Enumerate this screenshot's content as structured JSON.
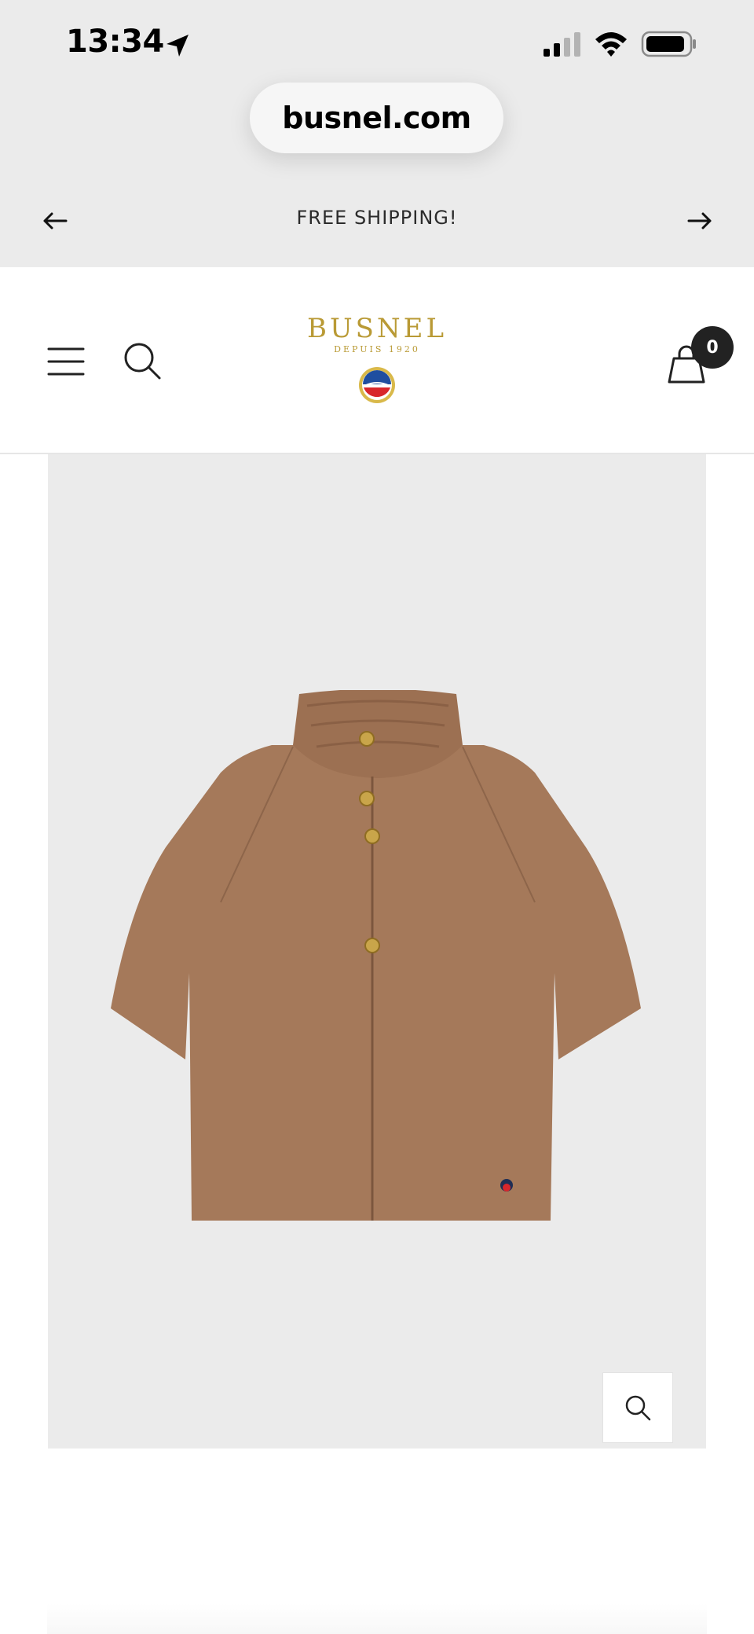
{
  "status_bar": {
    "time": "13:34",
    "icons": [
      "location-arrow-icon",
      "cellular-signal-icon",
      "wifi-icon",
      "battery-icon"
    ]
  },
  "browser": {
    "url": "busnel.com"
  },
  "announcement": {
    "text": "FREE SHIPPING!",
    "prev_icon": "arrow-left-icon",
    "next_icon": "arrow-right-icon"
  },
  "header": {
    "logo_text": "BUSNEL",
    "logo_subtitle": "DEPUIS 1920",
    "menu_icon": "hamburger-menu-icon",
    "search_icon": "search-icon",
    "cart_icon": "shopping-bag-icon",
    "cart_count": "0"
  },
  "product": {
    "image_alt": "camel knit cardigan",
    "zoom_icon": "zoom-search-icon"
  },
  "colors": {
    "chrome_bg": "#ebebeb",
    "logo_gold": "#b99a35",
    "cardigan": "#a5795a",
    "badge": "#222222"
  }
}
